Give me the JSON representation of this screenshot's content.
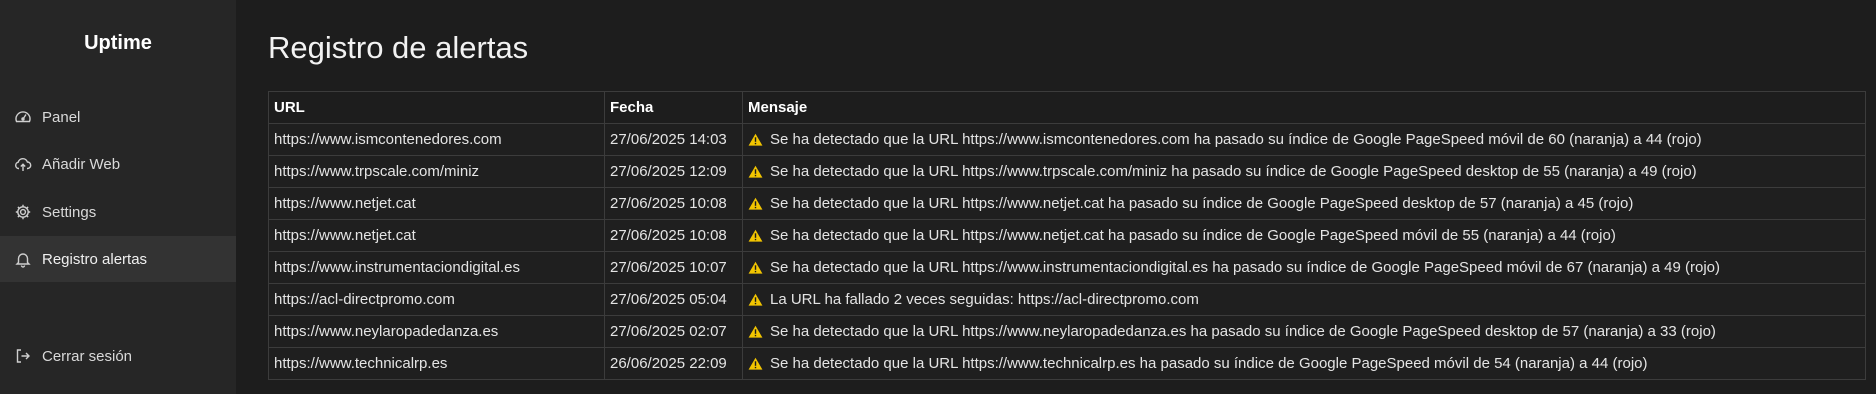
{
  "app": {
    "title": "Uptime"
  },
  "sidebar": {
    "items": [
      {
        "label": "Panel",
        "icon": "gauge-icon"
      },
      {
        "label": "Añadir Web",
        "icon": "cloud-upload-icon"
      },
      {
        "label": "Settings",
        "icon": "gear-icon"
      },
      {
        "label": "Registro alertas",
        "icon": "bell-icon",
        "active": true
      }
    ],
    "logout": {
      "label": "Cerrar sesión",
      "icon": "logout-icon"
    }
  },
  "main": {
    "title": "Registro de alertas",
    "table": {
      "headers": [
        "URL",
        "Fecha",
        "Mensaje"
      ],
      "rows": [
        {
          "url": "https://www.ismcontenedores.com",
          "fecha": "27/06/2025 14:03",
          "mensaje": "Se ha detectado que la URL https://www.ismcontenedores.com ha pasado su índice de Google PageSpeed móvil de 60 (naranja) a 44 (rojo)"
        },
        {
          "url": "https://www.trpscale.com/miniz",
          "fecha": "27/06/2025 12:09",
          "mensaje": "Se ha detectado que la URL https://www.trpscale.com/miniz ha pasado su índice de Google PageSpeed desktop de 55 (naranja) a 49 (rojo)"
        },
        {
          "url": "https://www.netjet.cat",
          "fecha": "27/06/2025 10:08",
          "mensaje": "Se ha detectado que la URL https://www.netjet.cat ha pasado su índice de Google PageSpeed desktop de 57 (naranja) a 45 (rojo)"
        },
        {
          "url": "https://www.netjet.cat",
          "fecha": "27/06/2025 10:08",
          "mensaje": "Se ha detectado que la URL https://www.netjet.cat ha pasado su índice de Google PageSpeed móvil de 55 (naranja) a 44 (rojo)"
        },
        {
          "url": "https://www.instrumentaciondigital.es",
          "fecha": "27/06/2025 10:07",
          "mensaje": "Se ha detectado que la URL https://www.instrumentaciondigital.es ha pasado su índice de Google PageSpeed móvil de 67 (naranja) a 49 (rojo)"
        },
        {
          "url": "https://acl-directpromo.com",
          "fecha": "27/06/2025 05:04",
          "mensaje": "La URL ha fallado 2 veces seguidas: https://acl-directpromo.com"
        },
        {
          "url": "https://www.neylaropadedanza.es",
          "fecha": "27/06/2025 02:07",
          "mensaje": "Se ha detectado que la URL https://www.neylaropadedanza.es ha pasado su índice de Google PageSpeed desktop de 57 (naranja) a 33 (rojo)"
        },
        {
          "url": "https://www.technicalrp.es",
          "fecha": "26/06/2025 22:09",
          "mensaje": "Se ha detectado que la URL https://www.technicalrp.es ha pasado su índice de Google PageSpeed móvil de 54 (naranja) a 44 (rojo)"
        }
      ]
    },
    "warning_icon": "warning-icon"
  },
  "colors": {
    "background": "#1d1d1d",
    "sidebar": "#262626",
    "sidebar_active": "#333333",
    "table_border": "#3c3c3c",
    "warning": "#f2c500"
  }
}
